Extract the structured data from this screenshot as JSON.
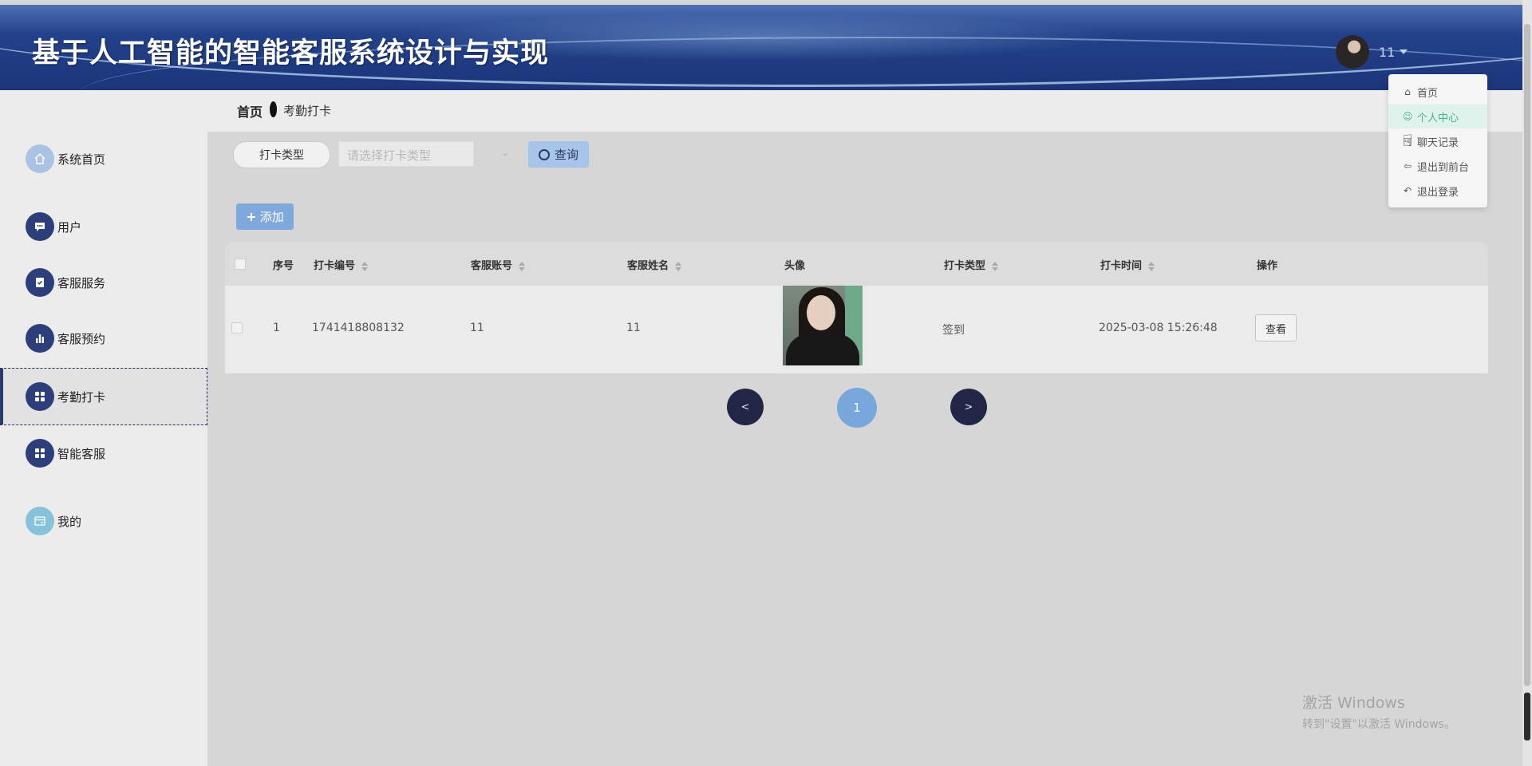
{
  "header": {
    "title": "基于人工智能的智能客服系统设计与实现",
    "user_name": "11"
  },
  "user_menu": {
    "items": [
      {
        "label": "首页",
        "icon": "home-icon"
      },
      {
        "label": "个人中心",
        "icon": "user-icon",
        "active": true
      },
      {
        "label": "聊天记录",
        "icon": "chat-icon"
      },
      {
        "label": "退出到前台",
        "icon": "back-arrow-icon"
      },
      {
        "label": "退出登录",
        "icon": "logout-icon"
      }
    ]
  },
  "sidebar": {
    "items": [
      {
        "label": "系统首页",
        "icon": "home-icon",
        "color": "#aac3e4"
      },
      {
        "label": "用户",
        "icon": "chat-bubble-icon",
        "color": "#2d3f7a"
      },
      {
        "label": "客服服务",
        "icon": "clipboard-check-icon",
        "color": "#2d3f7a"
      },
      {
        "label": "客服预约",
        "icon": "bar-chart-icon",
        "color": "#2d3f7a"
      },
      {
        "label": "考勤打卡",
        "icon": "grid-icon",
        "color": "#2d3f7a",
        "active": true
      },
      {
        "label": "智能客服",
        "icon": "grid-icon",
        "color": "#2d3f7a"
      },
      {
        "label": "我的",
        "icon": "card-icon",
        "color": "#86c3d8"
      }
    ]
  },
  "breadcrumb": {
    "home": "首页",
    "current": "考勤打卡"
  },
  "search": {
    "type_label": "打卡类型",
    "select_placeholder": "请选择打卡类型",
    "query_label": "查询"
  },
  "toolbar": {
    "add_label": "添加"
  },
  "table": {
    "headers": [
      "序号",
      "打卡编号",
      "客服账号",
      "客服姓名",
      "头像",
      "打卡类型",
      "打卡时间",
      "操作"
    ],
    "rows": [
      {
        "index": "1",
        "code": "1741418808132",
        "account": "11",
        "name": "11",
        "type": "签到",
        "time": "2025-03-08 15:26:48",
        "action": "查看"
      }
    ]
  },
  "pagination": {
    "prev": "<",
    "current": "1",
    "next": ">"
  },
  "watermark": {
    "title": "激活 Windows",
    "subtitle": "转到\"设置\"以激活 Windows。"
  },
  "colors": {
    "accent": "#77a7db",
    "header": "#23418a",
    "nav_icon": "#2d3f7a",
    "menu_active": "#42b48a"
  }
}
